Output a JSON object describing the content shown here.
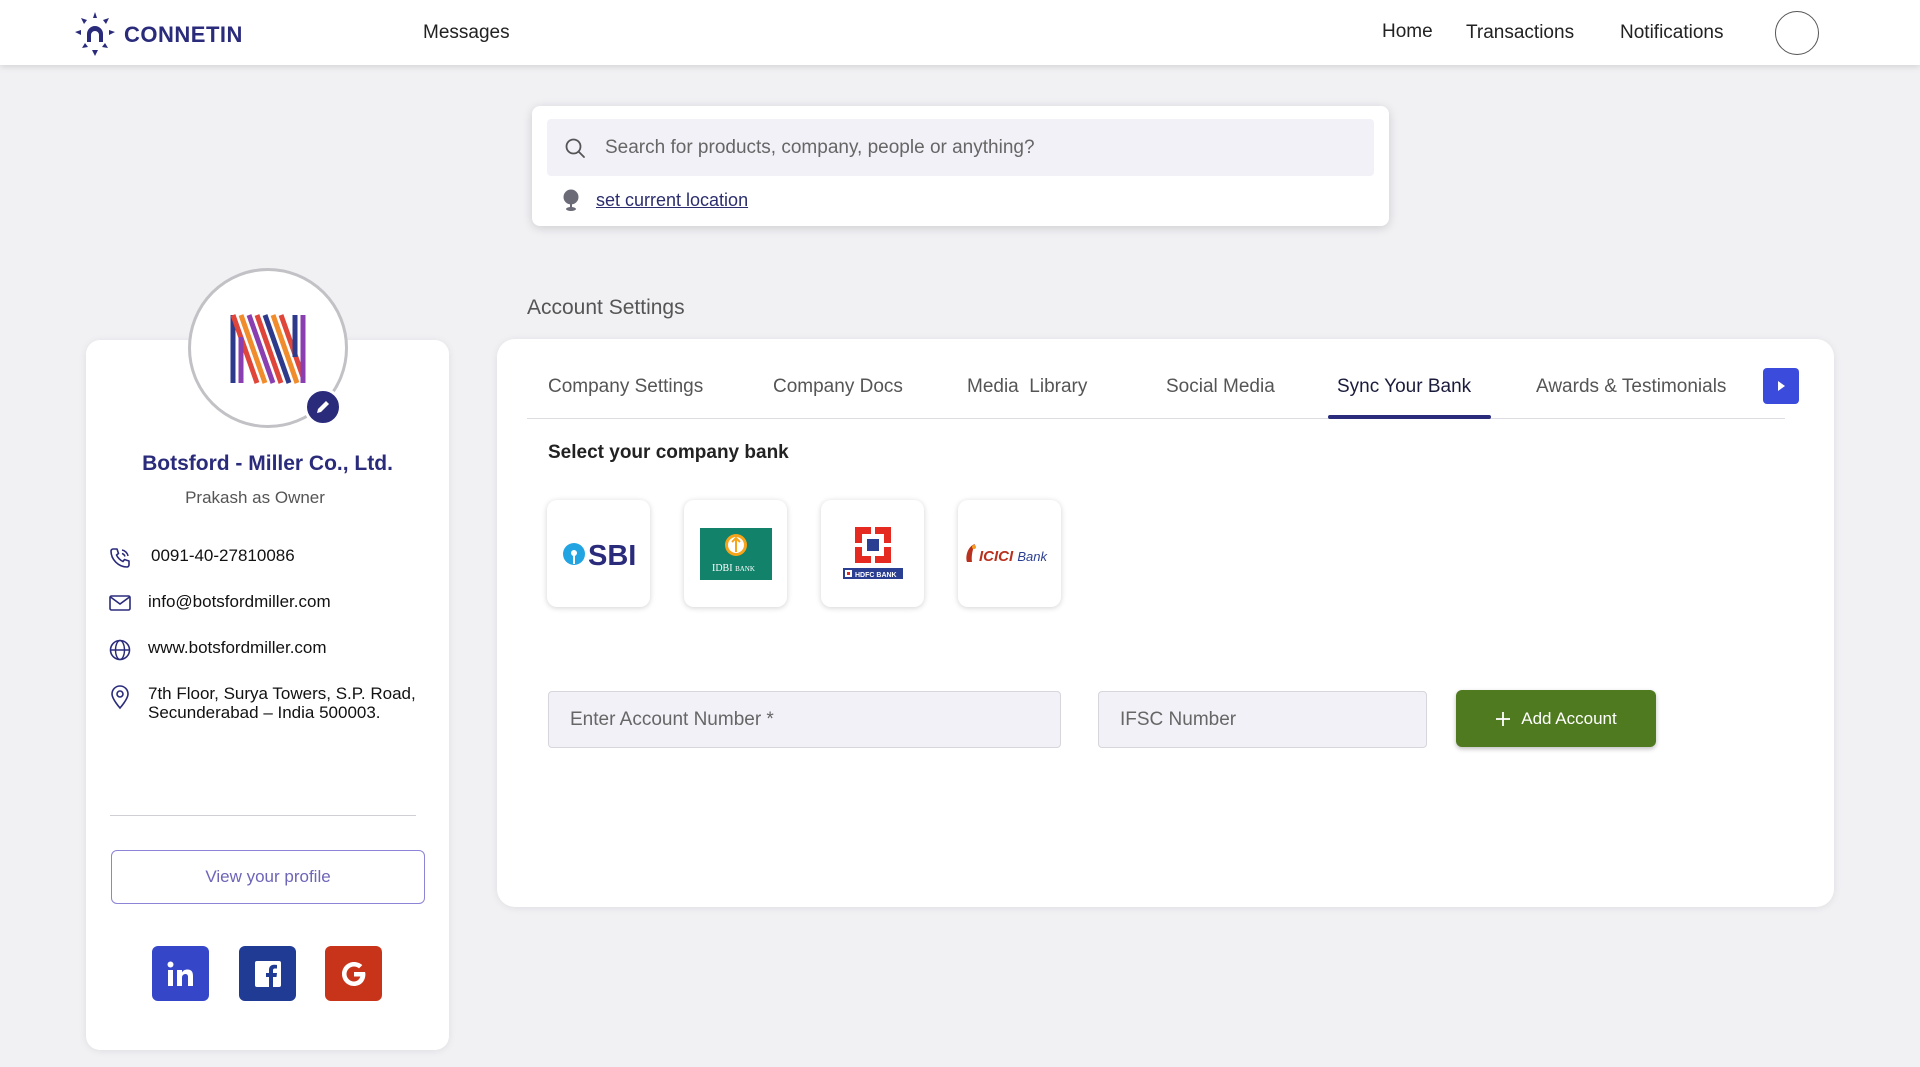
{
  "brand": {
    "name": "CONNETIN"
  },
  "nav": {
    "messages": "Messages",
    "home": "Home",
    "transactions": "Transactions",
    "notifications": "Notifications"
  },
  "search": {
    "placeholder": "Search for products, company, people or anything?",
    "location_link": "set current location"
  },
  "section_title": "Account Settings",
  "profile": {
    "company_name": "Botsford - Miller Co., Ltd.",
    "owner_line": "Prakash as Owner",
    "phone": "0091-40-27810086",
    "email": "info@botsfordmiller.com",
    "website": "www.botsfordmiller.com",
    "address_line1": "7th Floor, Surya Towers, S.P. Road,",
    "address_line2": "Secunderabad – India 500003.",
    "view_profile": "View your profile"
  },
  "tabs": [
    {
      "label": "Company Settings",
      "active": false
    },
    {
      "label": "Company Docs",
      "active": false
    },
    {
      "label": "Media  Library",
      "active": false
    },
    {
      "label": "Social Media",
      "active": false
    },
    {
      "label": "Sync Your Bank",
      "active": true
    },
    {
      "label": "Awards & Testimonials",
      "active": false
    }
  ],
  "bank_section": {
    "heading": "Select your company bank",
    "banks": [
      {
        "logo_text": "SBI"
      },
      {
        "logo_text": "IDBI",
        "logo_subtext": "BANK"
      },
      {
        "logo_text": "HDFC BANK"
      },
      {
        "logo_text": "ICICI",
        "logo_subtext": "Bank"
      }
    ],
    "account_placeholder": "Enter Account Number *",
    "ifsc_placeholder": "IFSC Number",
    "add_button": "Add Account"
  },
  "colors": {
    "brand_navy": "#2a2b7b",
    "add_button_green": "#4f7a1f",
    "tab_next_blue": "#3b4bdc",
    "linkedin": "#3546c9",
    "facebook": "#1f3b94",
    "google": "#c8341a"
  },
  "icons": {
    "search": "search-icon",
    "location": "location-pin-icon",
    "phone": "phone-icon",
    "email": "mail-icon",
    "website": "globe-icon",
    "address": "map-pin-icon",
    "edit": "pencil-icon",
    "next": "chevron-right-icon",
    "add": "plus-icon"
  }
}
